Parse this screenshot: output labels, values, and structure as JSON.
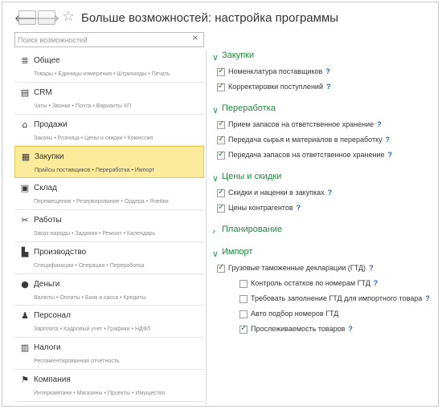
{
  "window": {
    "title": "Больше возможностей: настройка программы",
    "back_glyph": "🡐",
    "forward_glyph": "🡒",
    "star_glyph": "☆"
  },
  "search": {
    "placeholder": "Поиск возможностей",
    "value": "",
    "clear_glyph": "×"
  },
  "sidebar": {
    "items": [
      {
        "name": "Общее",
        "sub": "Товары • Единицы измерения • Штрихкоды • Печать",
        "icon": "list-icon",
        "glyph": "≣"
      },
      {
        "name": "CRM",
        "sub": "Чаты • Звонки • Почта • Варианты КП",
        "icon": "crm-icon",
        "glyph": "▤"
      },
      {
        "name": "Продажи",
        "sub": "Заказы • Розница • Цены и скидки • Комиссия",
        "icon": "store-icon",
        "glyph": "⌂"
      },
      {
        "name": "Закупки",
        "sub": "Прайсы поставщиков • Переработка • Импорт",
        "icon": "purchases-icon",
        "glyph": "▦",
        "selected": true
      },
      {
        "name": "Склад",
        "sub": "Перемещения • Резервирование • Ордера • Ячейки",
        "icon": "warehouse-icon",
        "glyph": "▣"
      },
      {
        "name": "Работы",
        "sub": "Заказ-наряды • Задания • Ремонт • Календарь",
        "icon": "tools-icon",
        "glyph": "✂"
      },
      {
        "name": "Производство",
        "sub": "Спецификации • Операции • Переработка",
        "icon": "factory-icon",
        "glyph": "▙"
      },
      {
        "name": "Деньги",
        "sub": "Валюты • Оплаты • Банк и касса • Кредиты",
        "icon": "money-icon",
        "glyph": "●"
      },
      {
        "name": "Персонал",
        "sub": "Зарплата • Кадровый учет • Графики • НДФЛ",
        "icon": "people-icon",
        "glyph": "♟"
      },
      {
        "name": "Налоги",
        "sub": "Регламентированная отчетность",
        "icon": "taxes-icon",
        "glyph": "▥"
      },
      {
        "name": "Компания",
        "sub": "Интеркампани • Магазины • Проекты • Имущество",
        "icon": "flag-icon",
        "glyph": "⚑"
      }
    ]
  },
  "groups": [
    {
      "title": "Закупки",
      "chevron": "∨",
      "options": [
        {
          "label": "Номенклатура поставщиков",
          "checked": true,
          "help": "?"
        },
        {
          "label": "Корректировки поступлений",
          "checked": true,
          "help": "?"
        }
      ]
    },
    {
      "title": "Переработка",
      "chevron": "∨",
      "options": [
        {
          "label": "Прием запасов на ответственное хранение",
          "checked": true,
          "help": "?"
        },
        {
          "label": "Передача сырья и материалов в переработку",
          "checked": true,
          "help": "?"
        },
        {
          "label": "Передача запасов на ответственное хранение",
          "checked": true,
          "help": "?"
        }
      ]
    },
    {
      "title": "Цены и скидки",
      "chevron": "∨",
      "options": [
        {
          "label": "Скидки и наценки в закупках",
          "checked": true,
          "help": "?"
        },
        {
          "label": "Цены контрагентов",
          "checked": true,
          "help": "?"
        }
      ]
    },
    {
      "title": "Планирование",
      "chevron": "›",
      "options": []
    },
    {
      "title": "Импорт",
      "chevron": "∨",
      "options": [
        {
          "label": "Грузовые таможенные декларации (ГТД)",
          "checked": true,
          "help": "?"
        },
        {
          "label": "Контроль остатков по номерам ГТД",
          "checked": false,
          "help": "?",
          "nested": true
        },
        {
          "label": "Требовать заполнение ГТД для импортного товара",
          "checked": false,
          "help": "?",
          "nested": true
        },
        {
          "label": "Авто подбор номеров ГТД",
          "checked": false,
          "help": "",
          "nested": true
        },
        {
          "label": "Прослеживаемость товаров",
          "checked": true,
          "help": "?",
          "nested": true
        }
      ]
    }
  ],
  "colors": {
    "accent_green": "#1a8a3a",
    "selected_bg": "#fbeb9a",
    "help_blue": "#2a5fc8"
  }
}
